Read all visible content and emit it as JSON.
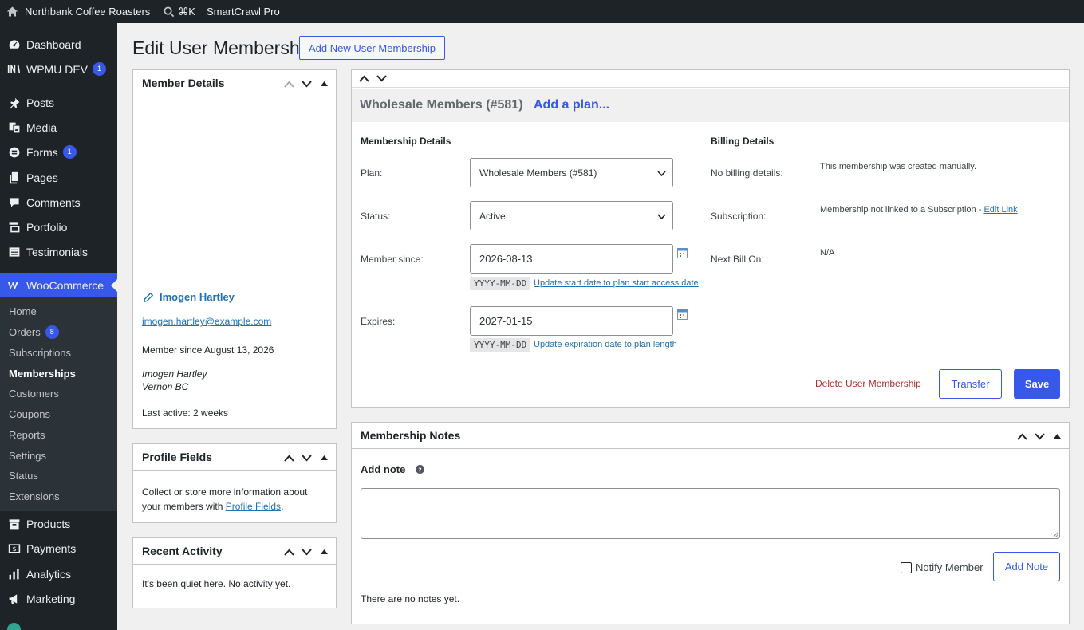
{
  "adminbar": {
    "site_name": "Northbank Coffee Roasters",
    "search_shortcut": "⌘K",
    "plugin_name": "SmartCrawl Pro"
  },
  "sidebar": {
    "items": [
      {
        "label": "Dashboard",
        "icon": "dashboard-icon"
      },
      {
        "label": "WPMU DEV",
        "icon": "wpmudev-icon",
        "badge": "1"
      },
      {
        "label": "Posts",
        "icon": "pin-icon"
      },
      {
        "label": "Media",
        "icon": "media-icon"
      },
      {
        "label": "Forms",
        "icon": "forms-icon",
        "badge": "1"
      },
      {
        "label": "Pages",
        "icon": "pages-icon"
      },
      {
        "label": "Comments",
        "icon": "comments-icon"
      },
      {
        "label": "Portfolio",
        "icon": "portfolio-icon"
      },
      {
        "label": "Testimonials",
        "icon": "testimonials-icon"
      },
      {
        "label": "WooCommerce",
        "icon": "woocommerce-icon"
      },
      {
        "label": "Products",
        "icon": "products-icon"
      },
      {
        "label": "Payments",
        "icon": "payments-icon"
      },
      {
        "label": "Analytics",
        "icon": "analytics-icon"
      },
      {
        "label": "Marketing",
        "icon": "marketing-icon"
      }
    ],
    "woo_submenu": [
      {
        "label": "Home"
      },
      {
        "label": "Orders",
        "badge": "8"
      },
      {
        "label": "Subscriptions"
      },
      {
        "label": "Memberships"
      },
      {
        "label": "Customers"
      },
      {
        "label": "Coupons"
      },
      {
        "label": "Reports"
      },
      {
        "label": "Settings"
      },
      {
        "label": "Status"
      },
      {
        "label": "Extensions"
      }
    ]
  },
  "page": {
    "title": "Edit User Membership",
    "add_new_label": "Add New User Membership"
  },
  "member_details": {
    "title": "Member Details",
    "name": "Imogen Hartley",
    "email": "imogen.hartley@example.com",
    "member_since": "Member since August 13, 2026",
    "address_line1": "Imogen Hartley",
    "address_line2": "Vernon BC",
    "last_active": "Last active: 2 weeks"
  },
  "profile_fields": {
    "title": "Profile Fields",
    "text_before": "Collect or store more information about your members with ",
    "link": "Profile Fields",
    "text_after": "."
  },
  "recent_activity": {
    "title": "Recent Activity",
    "text": "It's been quiet here. No activity yet."
  },
  "membership": {
    "tabs": [
      {
        "label": "Wholesale Members (#581)"
      },
      {
        "label": "Add a plan..."
      }
    ],
    "details_heading": "Membership Details",
    "plan_label": "Plan:",
    "plan_value": "Wholesale Members (#581)",
    "status_label": "Status:",
    "status_value": "Active",
    "since_label": "Member since:",
    "since_value": "2026-08-13",
    "date_format": "YYYY-MM-DD",
    "since_link": "Update start date to plan start access date",
    "expires_label": "Expires:",
    "expires_value": "2027-01-15",
    "expires_link": "Update expiration date to plan length",
    "billing_heading": "Billing Details",
    "no_billing_label": "No billing details:",
    "no_billing_value": "This membership was created manually.",
    "subscription_label": "Subscription:",
    "subscription_value": "Membership not linked to a Subscription - ",
    "edit_link": "Edit Link",
    "next_bill_label": "Next Bill On:",
    "next_bill_value": "N/A",
    "delete_label": "Delete User Membership",
    "transfer_label": "Transfer",
    "save_label": "Save"
  },
  "notes": {
    "title": "Membership Notes",
    "add_note_label": "Add note",
    "notify_label": "Notify Member",
    "add_note_button": "Add Note",
    "empty_text": "There are no notes yet."
  },
  "colors": {
    "accent": "#3858e9",
    "sidebar_bg": "#1d2327",
    "submenu_bg": "#2c3338",
    "link": "#2271b1",
    "delete": "#b32d2e"
  }
}
